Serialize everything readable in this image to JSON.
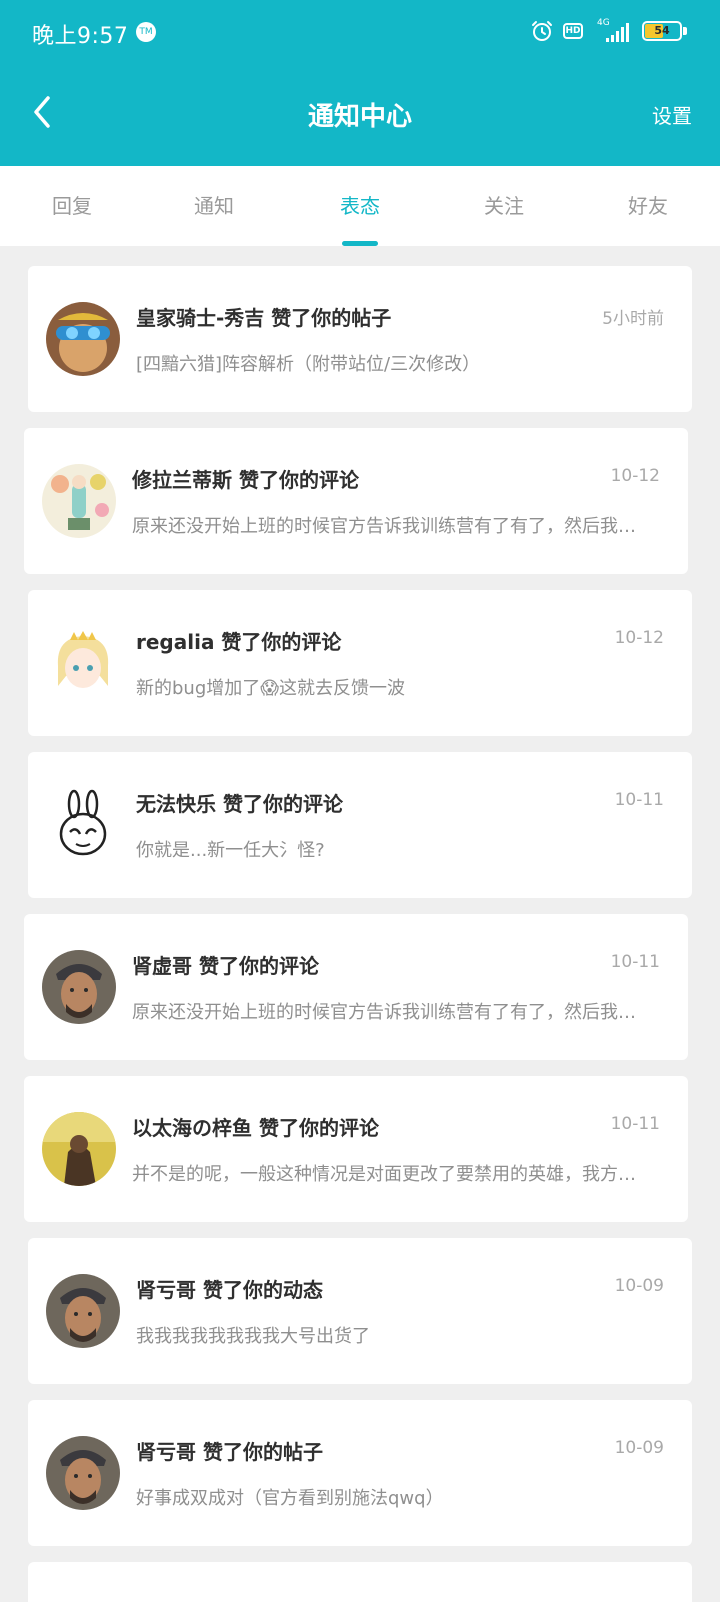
{
  "status_bar": {
    "time": "晚上9:57",
    "badge": "TM",
    "hd": "HD",
    "network": "4G",
    "battery": "54",
    "battery_level": 0.54
  },
  "nav": {
    "title": "通知中心",
    "settings": "设置"
  },
  "tabs": [
    {
      "label": "回复"
    },
    {
      "label": "通知"
    },
    {
      "label": "表态"
    },
    {
      "label": "关注"
    },
    {
      "label": "好友"
    }
  ],
  "active_tab": "表态",
  "notifications": [
    {
      "title": "皇家骑士-秀吉 赞了你的帖子",
      "time": "5小时前",
      "preview": "[四黯六猎]阵容解析（附带站位/三次修改）",
      "avatar": "goggles-character-avatar"
    },
    {
      "title": "修拉兰蒂斯 赞了你的评论",
      "time": "10-12",
      "preview": "原来还没开始上班的时候官方告诉我训练营有了有了，然后我…",
      "avatar": "floral-character-avatar"
    },
    {
      "title": "regalia 赞了你的评论",
      "time": "10-12",
      "preview": "新的bug增加了😱这就去反馈一波",
      "avatar": "anime-girl-avatar"
    },
    {
      "title": "无法快乐 赞了你的评论",
      "time": "10-11",
      "preview": "你就是...新一任大氵怪?",
      "avatar": "rabbit-sketch-avatar"
    },
    {
      "title": "肾虚哥 赞了你的评论",
      "time": "10-11",
      "preview": "原来还没开始上班的时候官方告诉我训练营有了有了，然后我…",
      "avatar": "man-portrait-avatar"
    },
    {
      "title": "以太海の梓鱼 赞了你的评论",
      "time": "10-11",
      "preview": "并不是的呢，一般这种情况是对面更改了要禁用的英雄，我方…",
      "avatar": "yellow-photo-avatar"
    },
    {
      "title": "肾亏哥 赞了你的动态",
      "time": "10-09",
      "preview": "我我我我我我我我大号出货了",
      "avatar": "man-portrait-avatar"
    },
    {
      "title": "肾亏哥 赞了你的帖子",
      "time": "10-09",
      "preview": "好事成双成对（官方看到别施法qwq）",
      "avatar": "man-portrait-avatar"
    }
  ],
  "colors": {
    "accent": "#13b7c7",
    "background": "#efefef"
  }
}
